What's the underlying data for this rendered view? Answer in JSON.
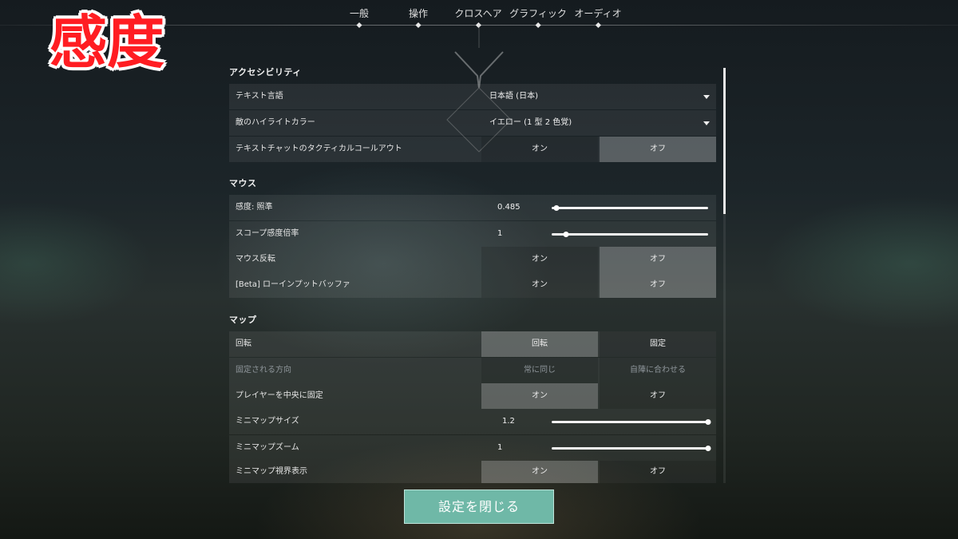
{
  "overlay_badge": "感度",
  "tabs": [
    "一般",
    "操作",
    "クロスヘア",
    "グラフィック",
    "オーディオ"
  ],
  "sections": {
    "accessibility": {
      "title": "アクセシビリティ",
      "text_language": {
        "label": "テキスト言語",
        "value": "日本語 (日本)"
      },
      "enemy_highlight": {
        "label": "敵のハイライトカラー",
        "value": "イエロー (1 型 2 色覚)"
      },
      "tactical_callouts": {
        "label": "テキストチャットのタクティカルコールアウト",
        "on": "オン",
        "off": "オフ",
        "selected": "off"
      }
    },
    "mouse": {
      "title": "マウス",
      "sensitivity": {
        "label": "感度: 照準",
        "value": "0.485",
        "level": 0.03
      },
      "scope_multiplier": {
        "label": "スコープ感度倍率",
        "value": "1",
        "level": 0.09
      },
      "invert": {
        "label": "マウス反転",
        "on": "オン",
        "off": "オフ",
        "selected": "off"
      },
      "raw_input": {
        "label": "[Beta] ローインプットバッファ",
        "on": "オン",
        "off": "オフ",
        "selected": "off"
      }
    },
    "map": {
      "title": "マップ",
      "rotate": {
        "label": "回転",
        "a": "回転",
        "b": "固定",
        "selected": "a"
      },
      "fixed_orientation": {
        "label": "固定される方向",
        "a": "常に同じ",
        "b": "自陣に合わせる"
      },
      "center_player": {
        "label": "プレイヤーを中央に固定",
        "on": "オン",
        "off": "オフ",
        "selected": "on"
      },
      "minimap_size": {
        "label": "ミニマップサイズ",
        "value": "1.2",
        "level": 1.0
      },
      "minimap_zoom": {
        "label": "ミニマップズーム",
        "value": "1",
        "level": 1.0
      },
      "minimap_vision": {
        "label": "ミニマップ視界表示",
        "on": "オン",
        "off": "オフ",
        "selected": "on"
      }
    }
  },
  "close_button": "設定を閉じる",
  "colors": {
    "accent": "#6fb8a7",
    "badge": "#ff1d22"
  }
}
